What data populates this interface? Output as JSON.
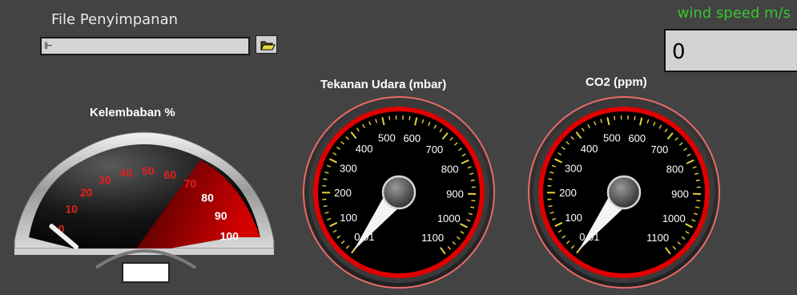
{
  "file_section": {
    "label": "File Penyimpanan",
    "path_value": "",
    "browse_icon": "folder-open-icon"
  },
  "wind": {
    "label": "wind speed m/s",
    "value": "0",
    "label_color": "#39c52f"
  },
  "humidity_gauge": {
    "title": "Kelembaban %",
    "scale_labels": [
      "0",
      "10",
      "20",
      "30",
      "40",
      "50",
      "60",
      "70",
      "80",
      "90",
      "100"
    ],
    "value": 0,
    "readout": "",
    "scale_color": "#e32020",
    "range_color": "#c00000"
  },
  "pressure_gauge": {
    "title": "Tekanan Udara (mbar)",
    "scale_labels": [
      "0.01",
      "100",
      "200",
      "300",
      "400",
      "500",
      "600",
      "700",
      "800",
      "900",
      "1000",
      "1100"
    ],
    "value": 0.01
  },
  "co2_gauge": {
    "title": "CO2 (ppm)",
    "scale_labels": [
      "0.01",
      "100",
      "200",
      "300",
      "400",
      "500",
      "600",
      "700",
      "800",
      "900",
      "1000",
      "1100"
    ],
    "value": 0.01
  }
}
